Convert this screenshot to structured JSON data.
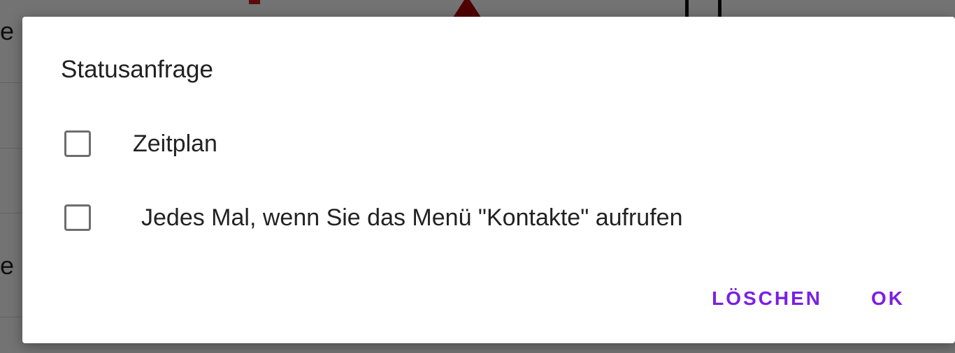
{
  "dialog": {
    "title": "Statusanfrage",
    "options": [
      {
        "label": "Zeitplan",
        "checked": false
      },
      {
        "label": "Jedes Mal, wenn Sie das Menü \"Kontakte\" aufrufen",
        "checked": false
      }
    ],
    "actions": {
      "clear_label": "LÖSCHEN",
      "ok_label": "OK"
    }
  },
  "background": {
    "heading_fragments": [
      "e",
      "e"
    ]
  },
  "colors": {
    "accent": "#7b1fe4",
    "scrim": "rgba(0,0,0,0.55)",
    "checkbox_border": "#6d6d6d",
    "background_alert": "#b00000"
  }
}
